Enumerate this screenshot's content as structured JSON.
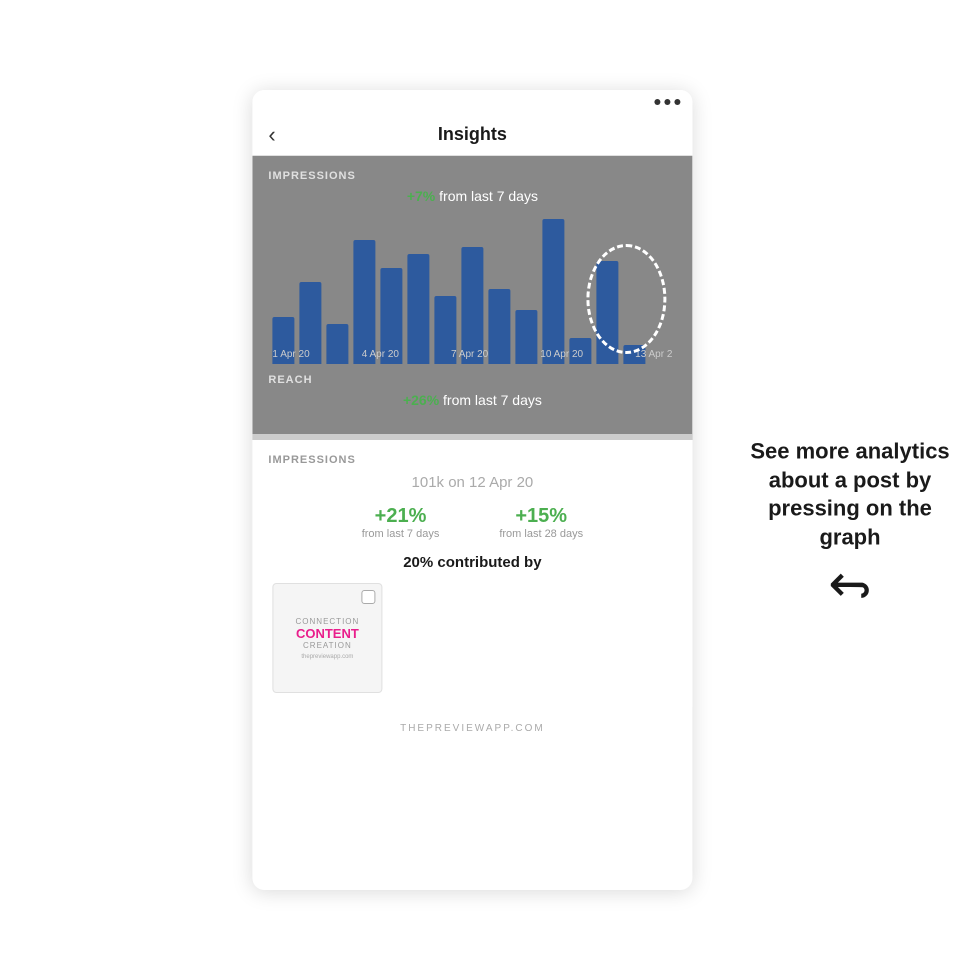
{
  "header": {
    "back_label": "‹",
    "title": "Insights"
  },
  "impressions_section": {
    "label": "IMPRESSIONS",
    "change_value": "+7%",
    "change_text": " from last 7 days",
    "x_labels": [
      "1 Apr 20",
      "4 Apr 20",
      "7 Apr 20",
      "10 Apr 20",
      "13 Apr 2"
    ],
    "bars": [
      30,
      55,
      25,
      85,
      65,
      75,
      45,
      80,
      50,
      35,
      100,
      15,
      70,
      10
    ]
  },
  "reach_section": {
    "label": "REACH",
    "change_value": "+26%",
    "change_text": " from last 7 days"
  },
  "detail_section": {
    "label": "IMPRESSIONS",
    "main_value": "101k on 12 Apr 20",
    "stat1_value": "+21%",
    "stat1_desc": "from last 7 days",
    "stat2_value": "+15%",
    "stat2_desc": "from last 28 days",
    "contributed_label": "20% contributed by",
    "thumbnail": {
      "line1": "CONNECTION",
      "line2": "CONTENT",
      "line3": "CREATION",
      "subtext": "thepreviewapp.com"
    }
  },
  "annotation": {
    "text": "See more analytics about a post by pressing on the graph"
  },
  "footer": {
    "text": "THEPREVIEWAPP.COM"
  }
}
